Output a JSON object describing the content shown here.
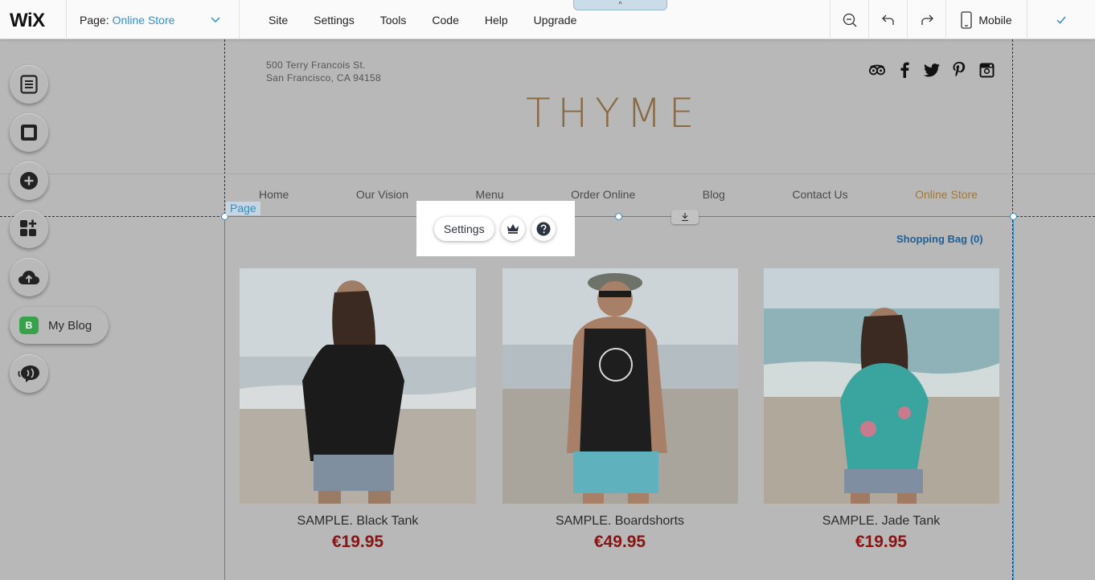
{
  "topbar": {
    "logo": "WiX",
    "page_prefix": "Page:",
    "page_current": "Online Store",
    "menu": [
      "Site",
      "Settings",
      "Tools",
      "Code",
      "Help",
      "Upgrade"
    ],
    "collapse_glyph": "^",
    "device_label": "Mobile"
  },
  "rail": {
    "items": [
      "pages-icon",
      "background-icon",
      "add-icon",
      "app-market-icon",
      "upload-icon",
      "my-blog-app",
      "chat-icon"
    ],
    "blog_badge": "B",
    "blog_label": "My Blog"
  },
  "site": {
    "address_line1": "500 Terry Francois St.",
    "address_line2": "San Francisco, CA 94158",
    "brand": "THYME",
    "social": [
      "tripadvisor-icon",
      "facebook-icon",
      "twitter-icon",
      "pinterest-icon",
      "instagram-icon"
    ],
    "nav": [
      "Home",
      "Our Vision",
      "Menu",
      "Order Online",
      "Blog",
      "Contact Us",
      "Online Store"
    ],
    "active_nav": "Online Store"
  },
  "editor": {
    "page_tag": "Page",
    "toolbar_settings": "Settings"
  },
  "store": {
    "shopping_bag": "Shopping Bag (0)",
    "products": [
      {
        "name": "SAMPLE. Black Tank",
        "price": "€19.95"
      },
      {
        "name": "SAMPLE. Boardshorts",
        "price": "€49.95"
      },
      {
        "name": "SAMPLE. Jade Tank",
        "price": "€19.95"
      }
    ]
  },
  "colors": {
    "accent": "#2f8fc6",
    "brand_gold": "#8a6a44",
    "price_red": "#8a1414",
    "overlay_gray": "#b8b8b8"
  }
}
